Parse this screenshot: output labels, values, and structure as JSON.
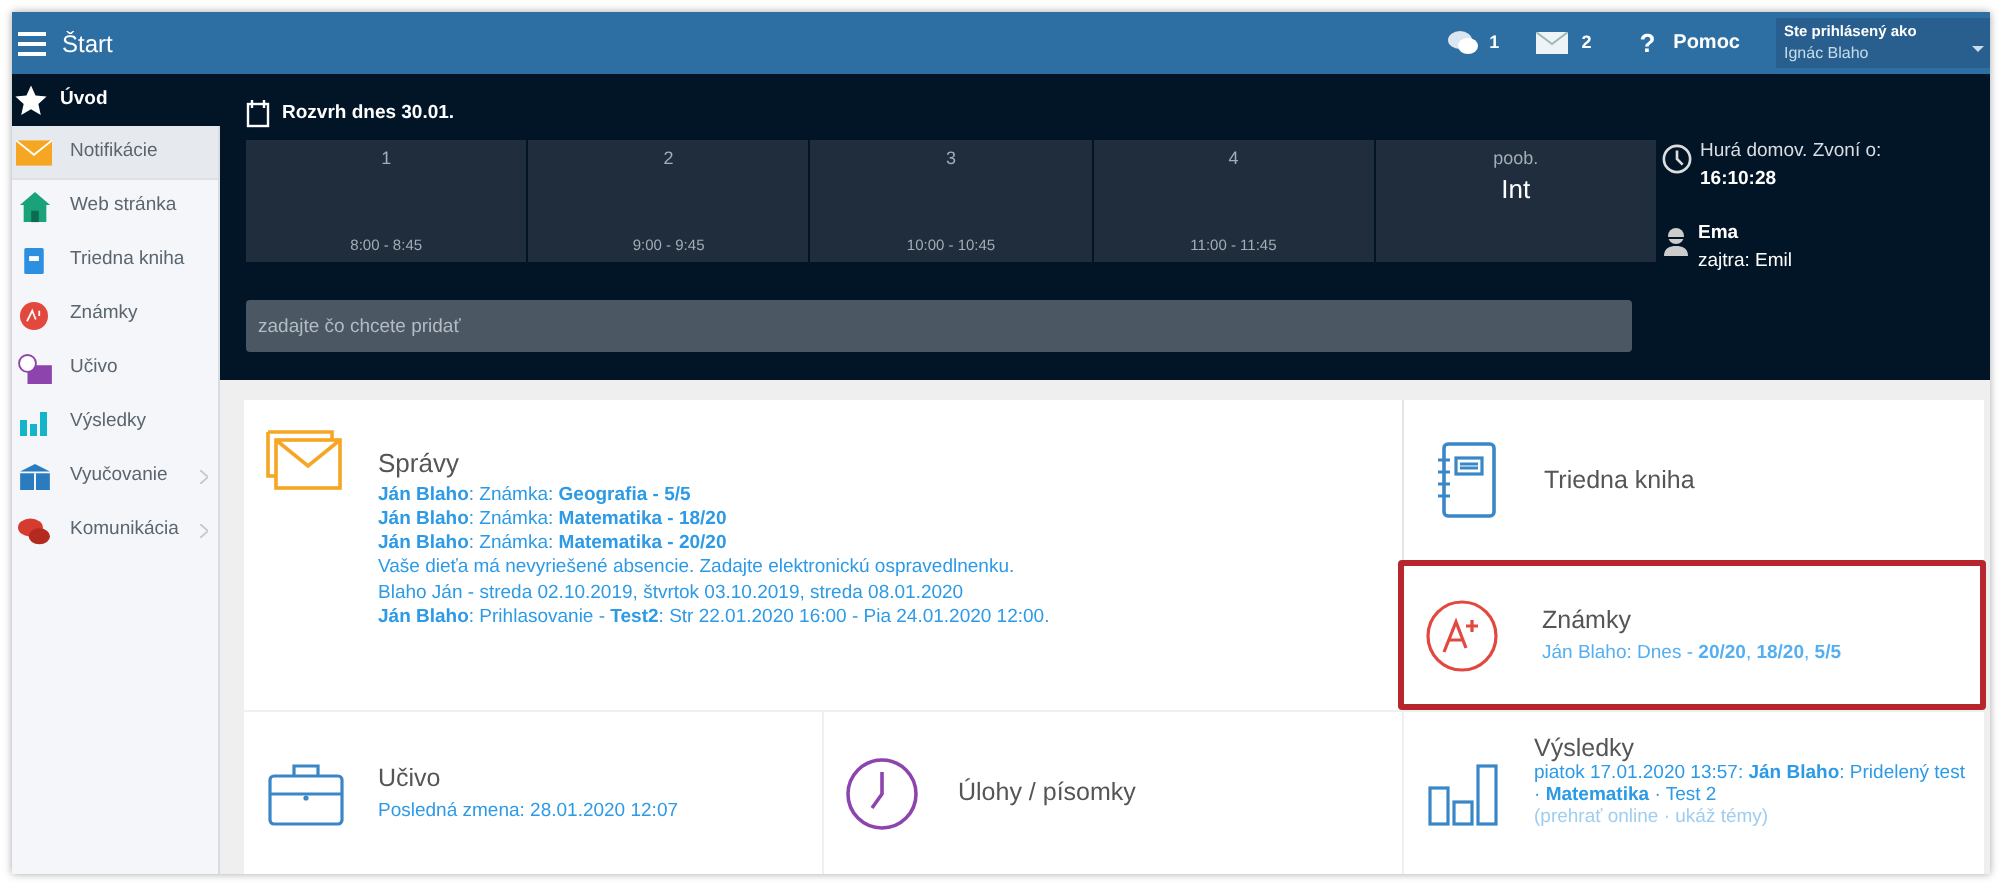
{
  "header": {
    "title": "Štart",
    "chat_count": "1",
    "mail_count": "2",
    "help_icon": "?",
    "help": "Pomoc",
    "user_label": "Ste prihlásený ako",
    "user_name": "Ignác Blaho"
  },
  "sidebar": {
    "home": "Úvod",
    "items": [
      {
        "kind": "mail",
        "label": "Notifikácie",
        "selected": true,
        "expandable": false
      },
      {
        "kind": "home",
        "label": "Web stránka",
        "selected": false,
        "expandable": false
      },
      {
        "kind": "book",
        "label": "Triedna kniha",
        "selected": false,
        "expandable": false
      },
      {
        "kind": "grade",
        "label": "Známky",
        "selected": false,
        "expandable": false
      },
      {
        "kind": "lesson",
        "label": "Učivo",
        "selected": false,
        "expandable": false
      },
      {
        "kind": "chart",
        "label": "Výsledky",
        "selected": false,
        "expandable": false
      },
      {
        "kind": "teach",
        "label": "Vyučovanie",
        "selected": false,
        "expandable": true
      },
      {
        "kind": "chat",
        "label": "Komunikácia",
        "selected": false,
        "expandable": true
      }
    ]
  },
  "schedule": {
    "title": "Rozvrh dnes 30.01.",
    "periods": [
      {
        "number": "1",
        "time": "8:00 - 8:45"
      },
      {
        "number": "2",
        "time": "9:00 - 9:45"
      },
      {
        "number": "3",
        "time": "10:00 - 10:45"
      },
      {
        "number": "4",
        "time": "11:00 - 11:45"
      },
      {
        "number": "poob.",
        "subject": "Int"
      }
    ],
    "bell_text": "Hurá domov. Zvoní o:",
    "bell_time": "16:10:28",
    "name_day": "Ema",
    "name_day_tomorrow": "zajtra: Emil"
  },
  "add_field": {
    "placeholder": "zadajte čo chcete pridať"
  },
  "tiles": {
    "messages": {
      "title": "Správy",
      "lines": [
        "**Ján Blaho**: Známka: **Geografia - 5/5**",
        "**Ján Blaho**: Známka: **Matematika - 18/20**",
        "**Ján Blaho**: Známka: **Matematika - 20/20**",
        "Vaše dieťa má nevyriešené absencie. Zadajte elektronickú ospravedlnenku.",
        "Blaho Ján - streda 02.10.2019, štvrtok 03.10.2019, streda 08.01.2020",
        "**Ján Blaho**: Prihlasovanie - **Test2**: Str 22.01.2020 16:00 - Pia 24.01.2020 12:00."
      ]
    },
    "class_book": {
      "title": "Triedna kniha"
    },
    "grades": {
      "title": "Známky",
      "detail": "Ján Blaho: Dnes - **20/20**, **18/20**, **5/5**",
      "highlighted": true
    },
    "lessons": {
      "title": "Učivo",
      "detail": "Posledná zmena: 28.01.2020 12:07"
    },
    "tasks": {
      "title": "Úlohy / písomky"
    },
    "results": {
      "title": "Výsledky",
      "detail": "piatok 17.01.2020 13:57: **Ján Blaho**: Pridelený test · **Matematika** · Test 2",
      "links": "(prehrať online · ukáž témy)"
    }
  }
}
